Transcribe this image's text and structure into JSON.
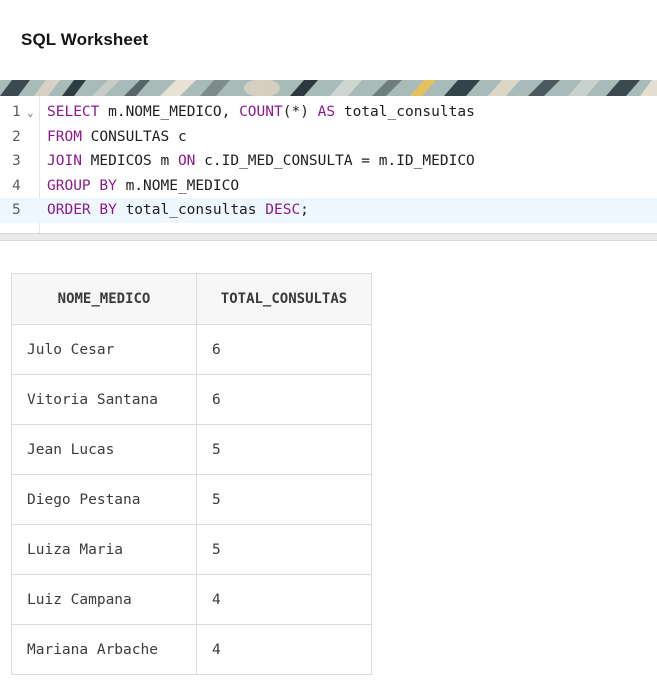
{
  "header": {
    "title": "SQL Worksheet"
  },
  "editor": {
    "lines": [
      {
        "number": "1",
        "tokens": [
          {
            "t": "SELECT",
            "kw": true
          },
          {
            "t": " m.NOME_MEDICO, ",
            "kw": false
          },
          {
            "t": "COUNT",
            "kw": true
          },
          {
            "t": "(*) ",
            "kw": false
          },
          {
            "t": "AS",
            "kw": true
          },
          {
            "t": " total_consultas",
            "kw": false
          }
        ]
      },
      {
        "number": "2",
        "tokens": [
          {
            "t": "FROM",
            "kw": true
          },
          {
            "t": " CONSULTAS c",
            "kw": false
          }
        ]
      },
      {
        "number": "3",
        "tokens": [
          {
            "t": "JOIN",
            "kw": true
          },
          {
            "t": " MEDICOS m ",
            "kw": false
          },
          {
            "t": "ON",
            "kw": true
          },
          {
            "t": " c.ID_MED_CONSULTA = m.ID_MEDICO",
            "kw": false
          }
        ]
      },
      {
        "number": "4",
        "tokens": [
          {
            "t": "GROUP BY",
            "kw": true
          },
          {
            "t": " m.NOME_MEDICO",
            "kw": false
          }
        ]
      },
      {
        "number": "5",
        "tokens": [
          {
            "t": "ORDER BY",
            "kw": true
          },
          {
            "t": " total_consultas ",
            "kw": false
          },
          {
            "t": "DESC",
            "kw": true
          },
          {
            "t": ";",
            "kw": false
          }
        ]
      }
    ],
    "active_line": 5,
    "fold_icon": "chevron-down-icon"
  },
  "results": {
    "columns": [
      "NOME_MEDICO",
      "TOTAL_CONSULTAS"
    ],
    "rows": [
      [
        "Julo Cesar",
        "6"
      ],
      [
        "Vitoria Santana",
        "6"
      ],
      [
        "Jean Lucas",
        "5"
      ],
      [
        "Diego Pestana",
        "5"
      ],
      [
        "Luiza Maria",
        "5"
      ],
      [
        "Luiz Campana",
        "4"
      ],
      [
        "Mariana Arbache",
        "4"
      ]
    ]
  },
  "colors": {
    "keyword": "#8c1a8e",
    "active_line": "#eef7fd"
  }
}
